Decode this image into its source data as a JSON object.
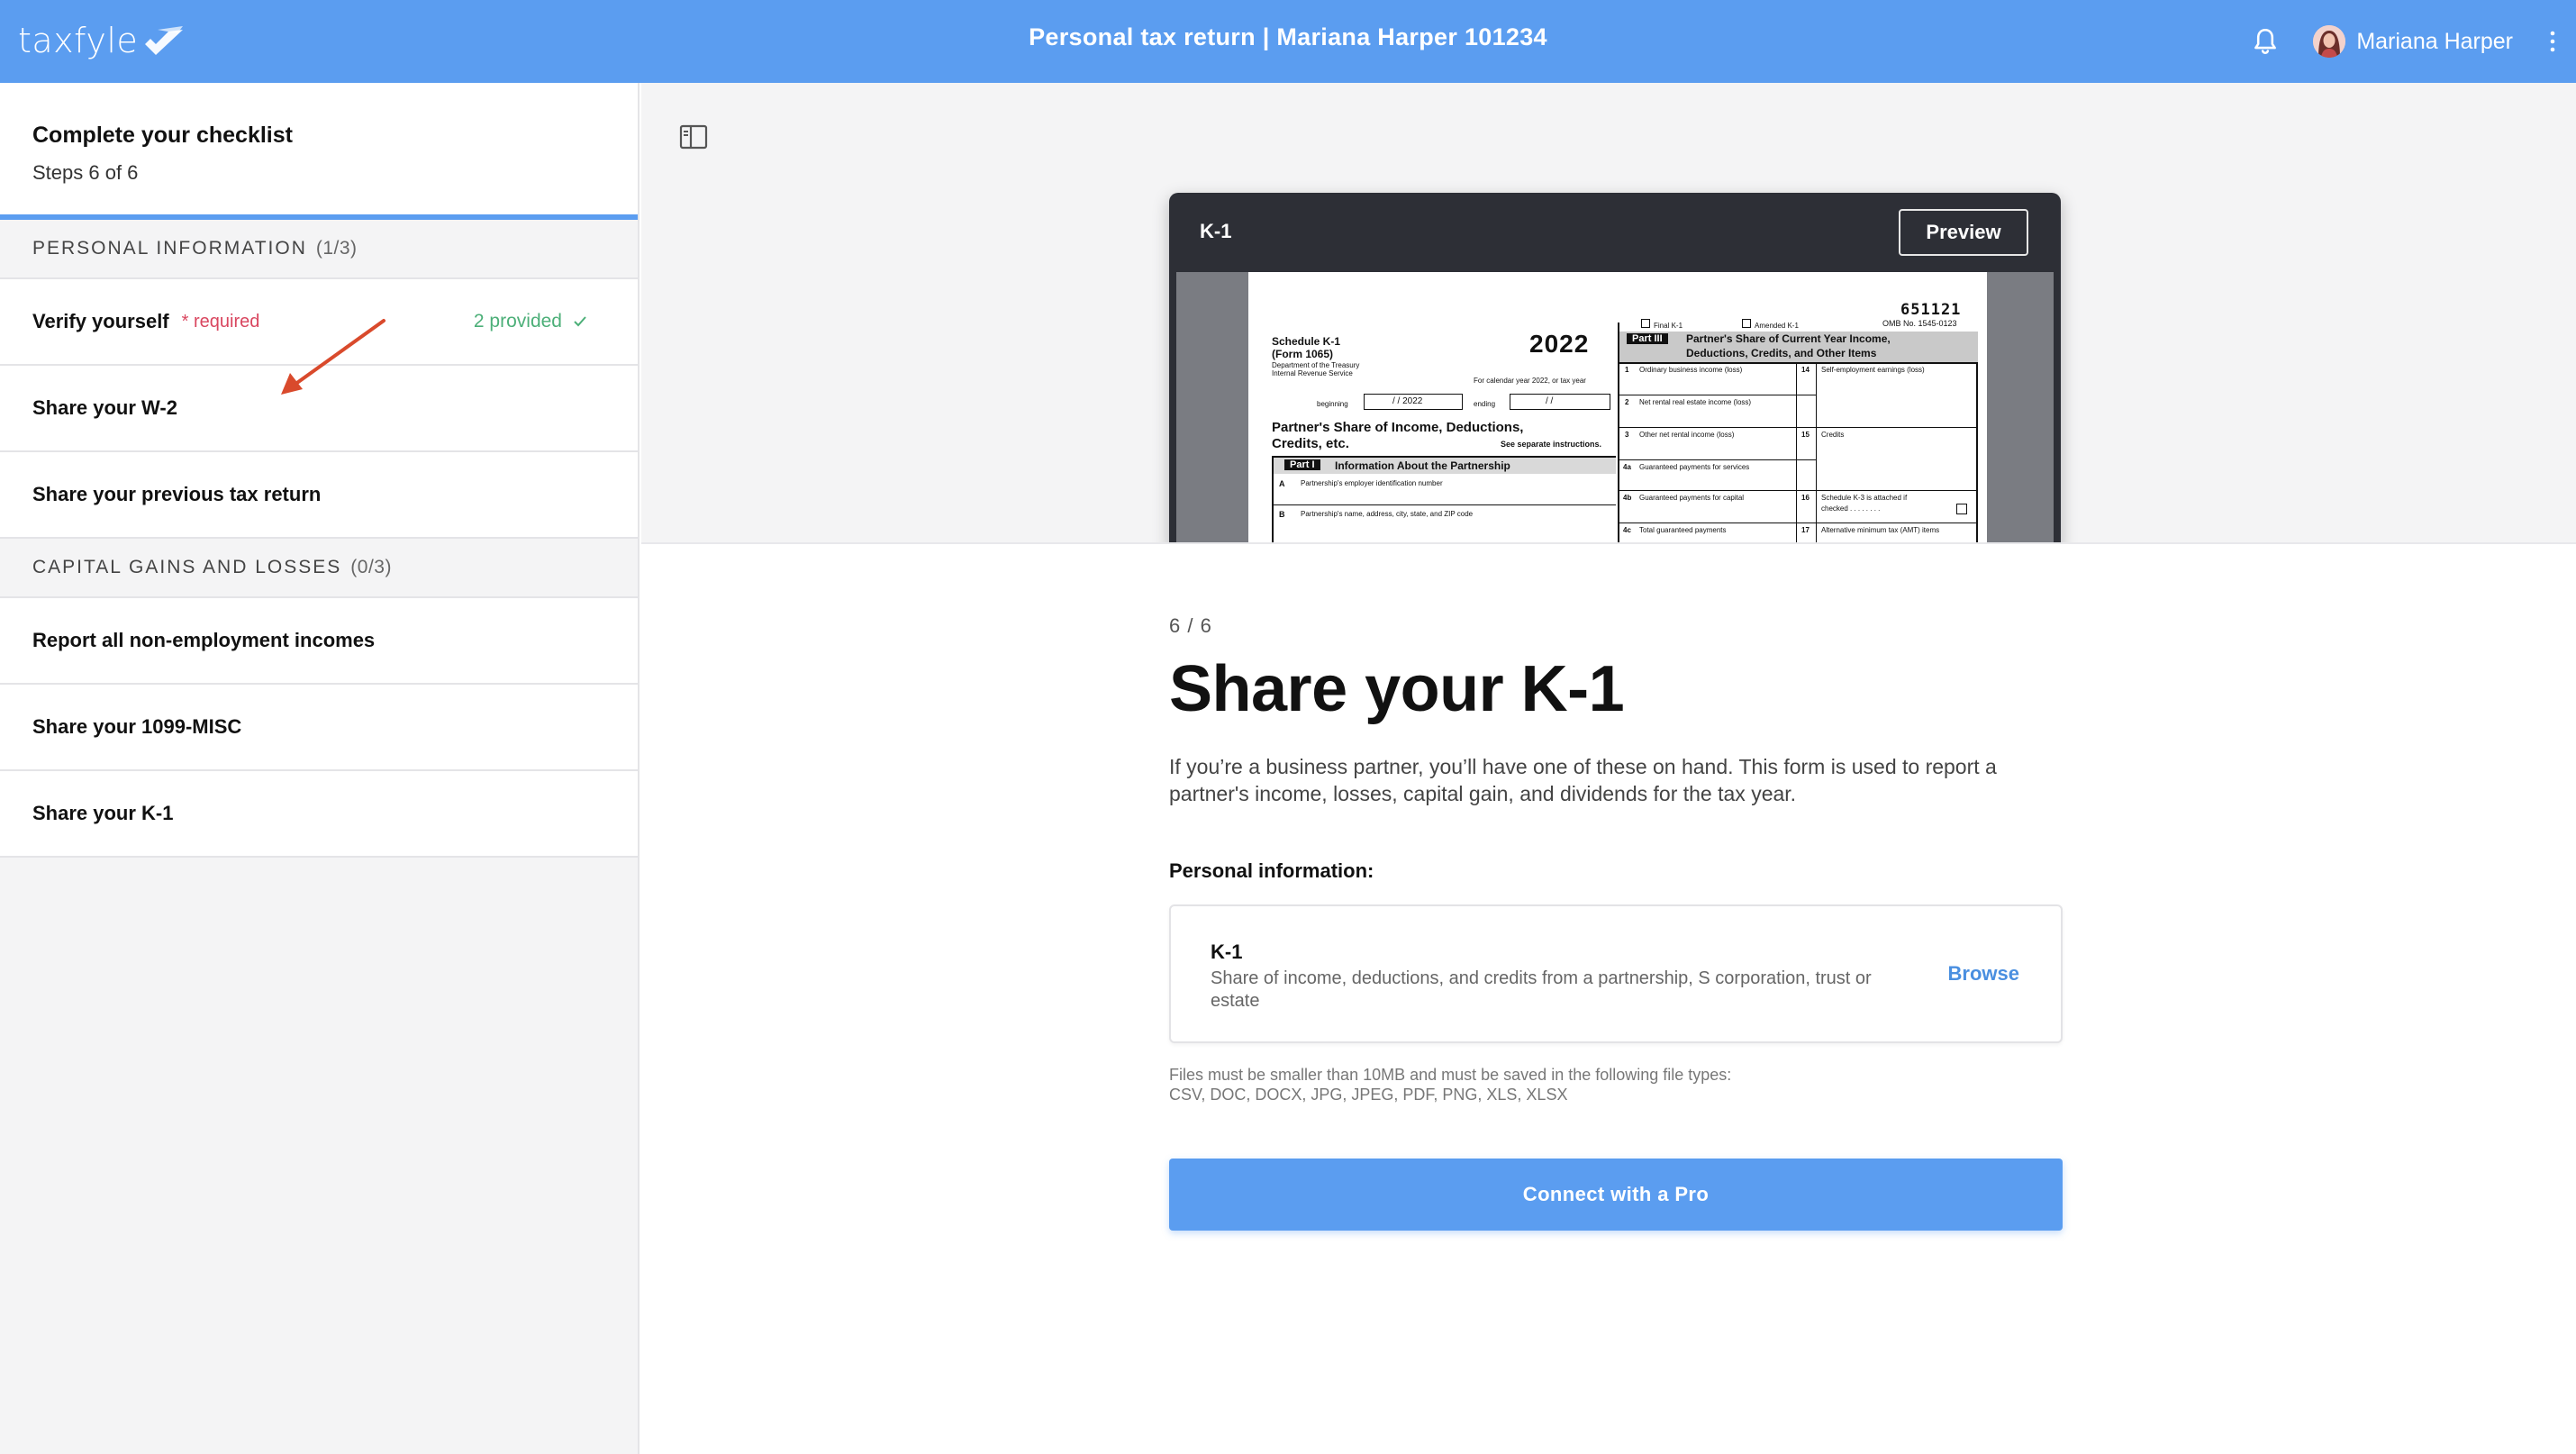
{
  "header": {
    "logo_text": "taxfyle",
    "title": "Personal tax return | Mariana Harper 101234",
    "user_name": "Mariana Harper",
    "accent": "#5b9df0"
  },
  "sidebar": {
    "title": "Complete your checklist",
    "steps": "Steps 6 of 6",
    "sections": [
      {
        "label": "PERSONAL INFORMATION",
        "count": "(1/3)",
        "items": [
          {
            "label": "Verify yourself",
            "required": "* required",
            "status": "2 provided"
          },
          {
            "label": "Share your W-2"
          },
          {
            "label": "Share your previous tax return"
          }
        ]
      },
      {
        "label": "CAPITAL GAINS AND LOSSES",
        "count": "(0/3)",
        "items": [
          {
            "label": "Report all non-employment incomes"
          },
          {
            "label": "Share your 1099-MISC"
          },
          {
            "label": "Share your K-1"
          }
        ]
      }
    ]
  },
  "preview": {
    "title": "K-1",
    "button": "Preview",
    "form": {
      "code": "651121",
      "omb": "OMB No. 1545-0123",
      "schedule": "Schedule K-1",
      "form_no": "(Form 1065)",
      "dept": "Department of the Treasury",
      "irs": "Internal Revenue Service",
      "year": "2022",
      "calendar": "For calendar year 2022, or tax year",
      "beginning": "beginning",
      "begin_date": "/    /  2022",
      "ending": "ending",
      "end_date": "/    /",
      "heading1": "Partner's Share of Income, Deductions,",
      "heading2": "Credits, etc.",
      "see_instr": "See separate instructions.",
      "part1": "Part I",
      "part1_title": "Information About the Partnership",
      "lineA_letter": "A",
      "lineA": "Partnership's employer identification number",
      "lineB_letter": "B",
      "lineB": "Partnership's name, address, city, state, and ZIP code",
      "final": "Final K-1",
      "amended": "Amended K-1",
      "part3": "Part III",
      "part3_title1": "Partner's Share of Current Year Income,",
      "part3_title2": "Deductions, Credits, and Other Items",
      "left_rows": [
        {
          "num": "1",
          "label": "Ordinary business income (loss)"
        },
        {
          "num": "2",
          "label": "Net rental real estate income (loss)"
        },
        {
          "num": "3",
          "label": "Other net rental income (loss)"
        },
        {
          "num": "4a",
          "label": "Guaranteed payments for services"
        },
        {
          "num": "4b",
          "label": "Guaranteed payments for capital"
        },
        {
          "num": "4c",
          "label": "Total guaranteed payments"
        }
      ],
      "right_rows": [
        {
          "num": "14",
          "label": "Self-employment earnings (loss)"
        },
        {
          "num": "15",
          "label": "Credits"
        },
        {
          "num": "16",
          "label": "Schedule K-3 is attached if"
        },
        {
          "num": "",
          "label": "checked . . . . . . . ."
        },
        {
          "num": "17",
          "label": "Alternative minimum tax (AMT) items"
        }
      ]
    }
  },
  "content": {
    "step": "6 / 6",
    "title": "Share your K-1",
    "description": "If you’re a business partner, you’ll have one of these on hand. This form is used to report a partner's income, losses, capital gain, and dividends for the tax year.",
    "section_label": "Personal information:",
    "upload": {
      "title": "K-1",
      "description": "Share of income, deductions, and credits from a partnership, S corporation, trust or estate",
      "action": "Browse"
    },
    "file_note_1": "Files must be smaller than 10MB and must be saved in the following file types:",
    "file_note_2": "CSV, DOC, DOCX, JPG, JPEG, PDF, PNG, XLS, XLSX",
    "cta": "Connect with a Pro"
  }
}
